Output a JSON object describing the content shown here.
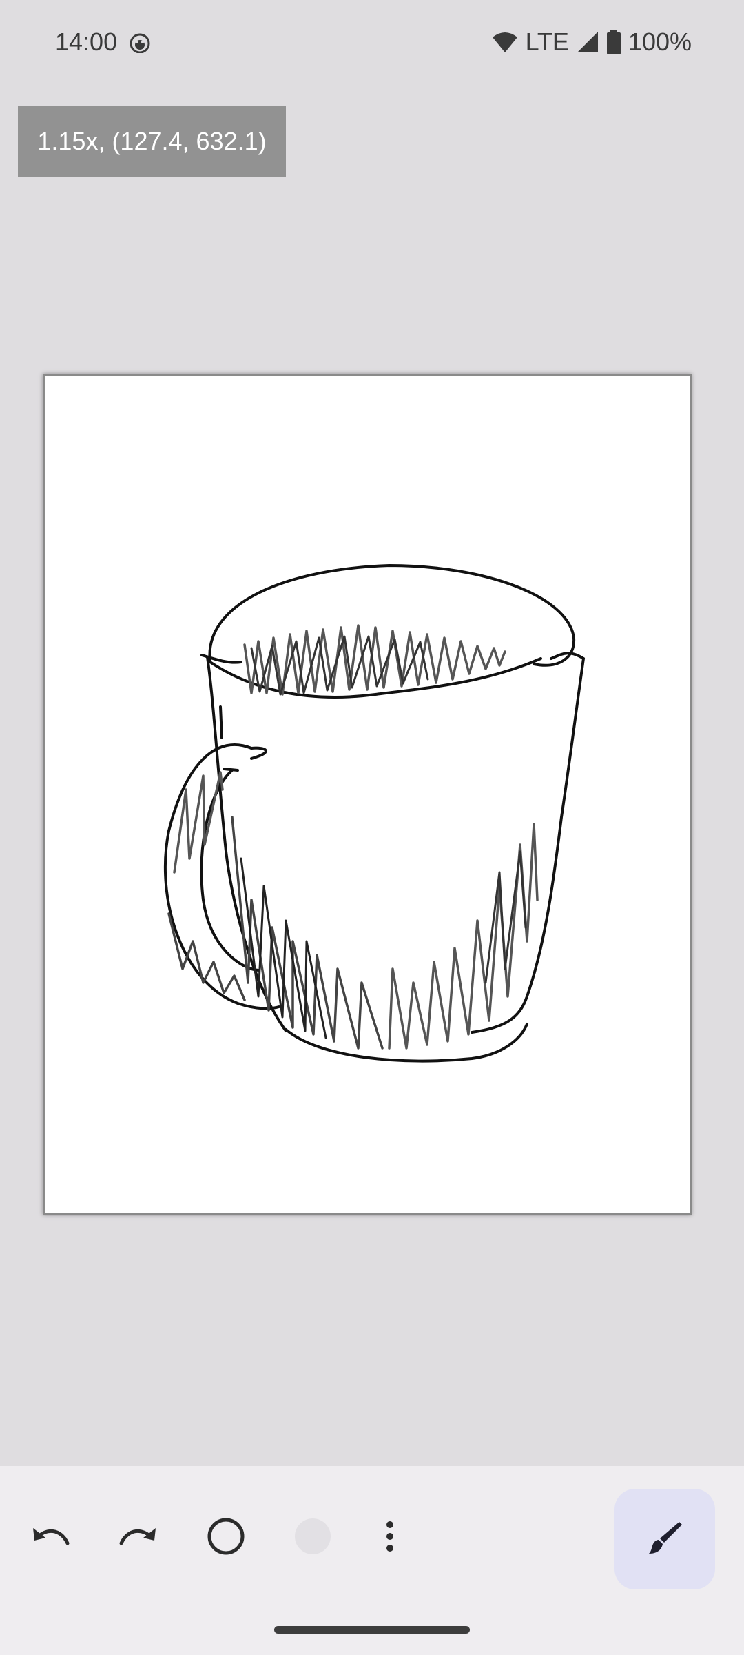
{
  "status_bar": {
    "time": "14:00",
    "network": "LTE",
    "battery": "100%",
    "icons": [
      "face-notification-icon",
      "wifi-icon",
      "cell-signal-icon",
      "battery-icon"
    ]
  },
  "readout": {
    "text": "1.15x, (127.4, 632.1)"
  },
  "canvas": {
    "background": "#ffffff",
    "drawing": "mug-sketch"
  },
  "toolbar": {
    "undo_icon": "undo-icon",
    "redo_icon": "redo-icon",
    "brush_size_icon": "circle-outline-icon",
    "color_icon": "color-swatch-icon",
    "color": "#e2e0e4",
    "more_icon": "more-vert-icon",
    "brush_icon": "brush-icon",
    "brush_active_bg": "#e1e1f4"
  }
}
